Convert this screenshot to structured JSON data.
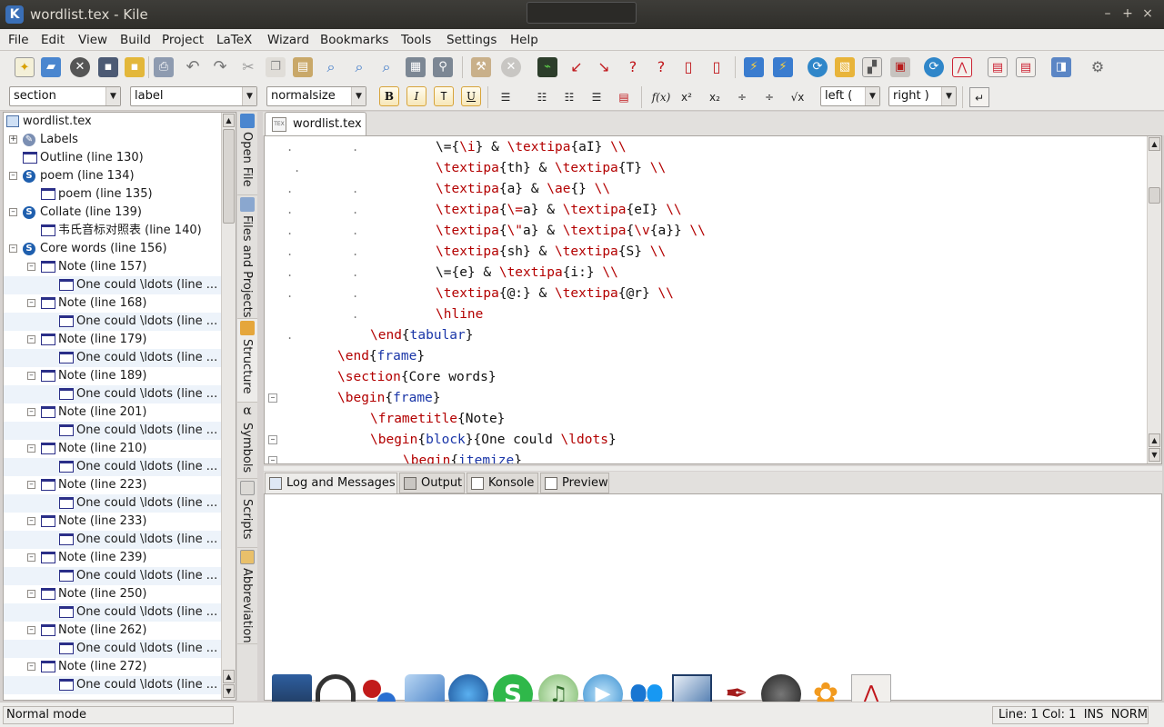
{
  "window": {
    "title": "wordlist.tex - Kile"
  },
  "menu": [
    "File",
    "Edit",
    "View",
    "Build",
    "Project",
    "LaTeX",
    "Wizard",
    "Bookmarks",
    "Tools",
    "Settings",
    "Help"
  ],
  "toolbar2": {
    "section_combo": "section",
    "label_combo": "label",
    "size_combo": "normalsize",
    "format_buttons": [
      "B",
      "I",
      "T",
      "U"
    ],
    "left_delim": "left (",
    "right_delim": "right )",
    "fx_label": "f(x)",
    "sqrt_label": "√x"
  },
  "structure": {
    "root": "wordlist.tex",
    "rows": [
      {
        "label": "Labels",
        "type": "labels"
      },
      {
        "label": "Outline (line 130)",
        "type": "frame"
      },
      {
        "label": "poem (line 134)",
        "type": "section"
      },
      {
        "label": "poem (line 135)",
        "type": "frame"
      },
      {
        "label": "Collate (line 139)",
        "type": "section"
      },
      {
        "label": "韦氏音标对照表 (line 140)",
        "type": "frame"
      },
      {
        "label": "Core words (line 156)",
        "type": "section"
      },
      {
        "label": "Note (line 157)",
        "type": "frame"
      },
      {
        "label": "One could \\ldots (line ...",
        "type": "block"
      },
      {
        "label": "Note (line 168)",
        "type": "frame"
      },
      {
        "label": "One could \\ldots (line ...",
        "type": "block"
      },
      {
        "label": "Note (line 179)",
        "type": "frame"
      },
      {
        "label": "One could \\ldots (line ...",
        "type": "block"
      },
      {
        "label": "Note (line 189)",
        "type": "frame"
      },
      {
        "label": "One could \\ldots (line ...",
        "type": "block"
      },
      {
        "label": "Note (line 201)",
        "type": "frame"
      },
      {
        "label": "One could \\ldots (line ...",
        "type": "block"
      },
      {
        "label": "Note (line 210)",
        "type": "frame"
      },
      {
        "label": "One could \\ldots (line ...",
        "type": "block"
      },
      {
        "label": "Note (line 223)",
        "type": "frame"
      },
      {
        "label": "One could \\ldots (line ...",
        "type": "block"
      },
      {
        "label": "Note (line 233)",
        "type": "frame"
      },
      {
        "label": "One could \\ldots (line ...",
        "type": "block"
      },
      {
        "label": "Note (line 239)",
        "type": "frame"
      },
      {
        "label": "One could \\ldots (line ...",
        "type": "block"
      },
      {
        "label": "Note (line 250)",
        "type": "frame"
      },
      {
        "label": "One could \\ldots (line ...",
        "type": "block"
      },
      {
        "label": "Note (line 262)",
        "type": "frame"
      },
      {
        "label": "One could \\ldots (line ...",
        "type": "block"
      },
      {
        "label": "Note (line 272)",
        "type": "frame"
      },
      {
        "label": "One could \\ldots (line ...",
        "type": "block"
      }
    ]
  },
  "side_tabs": [
    "Open File",
    "Files and Projects",
    "Structure",
    "Symbols",
    "Scripts",
    "Abbreviation"
  ],
  "editor": {
    "tab": "wordlist.tex",
    "lines": [
      [
        {
          "t": "\\={"
        },
        {
          "t": "\\i",
          "c": "cmd"
        },
        {
          "t": "} & "
        },
        {
          "t": "\\textipa",
          "c": "cmd"
        },
        {
          "t": "{aI} "
        },
        {
          "t": "\\\\",
          "c": "cmd"
        }
      ],
      [
        {
          "t": "\\textipa",
          "c": "cmd"
        },
        {
          "t": "{th} & "
        },
        {
          "t": "\\textipa",
          "c": "cmd"
        },
        {
          "t": "{T} "
        },
        {
          "t": "\\\\",
          "c": "cmd"
        }
      ],
      [
        {
          "t": "\\textipa",
          "c": "cmd"
        },
        {
          "t": "{a} & "
        },
        {
          "t": "\\ae",
          "c": "cmd"
        },
        {
          "t": "{} "
        },
        {
          "t": "\\\\",
          "c": "cmd"
        }
      ],
      [
        {
          "t": "\\textipa",
          "c": "cmd"
        },
        {
          "t": "{"
        },
        {
          "t": "\\=",
          "c": "cmd"
        },
        {
          "t": "a} & "
        },
        {
          "t": "\\textipa",
          "c": "cmd"
        },
        {
          "t": "{eI} "
        },
        {
          "t": "\\\\",
          "c": "cmd"
        }
      ],
      [
        {
          "t": "\\textipa",
          "c": "cmd"
        },
        {
          "t": "{"
        },
        {
          "t": "\\\"",
          "c": "cmd"
        },
        {
          "t": "a} & "
        },
        {
          "t": "\\textipa",
          "c": "cmd"
        },
        {
          "t": "{"
        },
        {
          "t": "\\v",
          "c": "cmd"
        },
        {
          "t": "{a}} "
        },
        {
          "t": "\\\\",
          "c": "cmd"
        }
      ],
      [
        {
          "t": "\\textipa",
          "c": "cmd"
        },
        {
          "t": "{sh} & "
        },
        {
          "t": "\\textipa",
          "c": "cmd"
        },
        {
          "t": "{S} "
        },
        {
          "t": "\\\\",
          "c": "cmd"
        }
      ],
      [
        {
          "t": "\\={e} & "
        },
        {
          "t": "\\textipa",
          "c": "cmd"
        },
        {
          "t": "{i:} "
        },
        {
          "t": "\\\\",
          "c": "cmd"
        }
      ],
      [
        {
          "t": "\\textipa",
          "c": "cmd"
        },
        {
          "t": "{@:} & "
        },
        {
          "t": "\\textipa",
          "c": "cmd"
        },
        {
          "t": "{@r} "
        },
        {
          "t": "\\\\",
          "c": "cmd"
        }
      ],
      [
        {
          "t": "\\hline",
          "c": "cmd"
        }
      ],
      [
        {
          "t": "\\end",
          "c": "cmd"
        },
        {
          "t": "{"
        },
        {
          "t": "tabular",
          "c": "env"
        },
        {
          "t": "}"
        }
      ],
      [
        {
          "t": "\\end",
          "c": "cmd"
        },
        {
          "t": "{"
        },
        {
          "t": "frame",
          "c": "env"
        },
        {
          "t": "}"
        }
      ],
      [
        {
          "t": "\\section",
          "c": "cmd"
        },
        {
          "t": "{Core words}"
        }
      ],
      [
        {
          "t": "\\begin",
          "c": "cmd"
        },
        {
          "t": "{"
        },
        {
          "t": "frame",
          "c": "env"
        },
        {
          "t": "}"
        }
      ],
      [
        {
          "t": "\\frametitle",
          "c": "cmd"
        },
        {
          "t": "{Note}"
        }
      ],
      [
        {
          "t": "\\begin",
          "c": "cmd"
        },
        {
          "t": "{"
        },
        {
          "t": "block",
          "c": "env"
        },
        {
          "t": "}{One could "
        },
        {
          "t": "\\ldots",
          "c": "cmd"
        },
        {
          "t": "}"
        }
      ],
      [
        {
          "t": "\\begin",
          "c": "cmd"
        },
        {
          "t": "{"
        },
        {
          "t": "itemize",
          "c": "env"
        },
        {
          "t": "}"
        }
      ]
    ]
  },
  "bottom_tabs": [
    "Log and Messages",
    "Output",
    "Konsole",
    "Preview"
  ],
  "dock": [
    "laptop",
    "headphones",
    "media-balls",
    "email",
    "browser",
    "skype",
    "itunes",
    "media-player",
    "messenger",
    "draw",
    "pen",
    "speaker",
    "flower",
    "pdf"
  ],
  "status": {
    "mode": "Normal mode",
    "position": "Line: 1 Col: 1  INS  NORM"
  }
}
